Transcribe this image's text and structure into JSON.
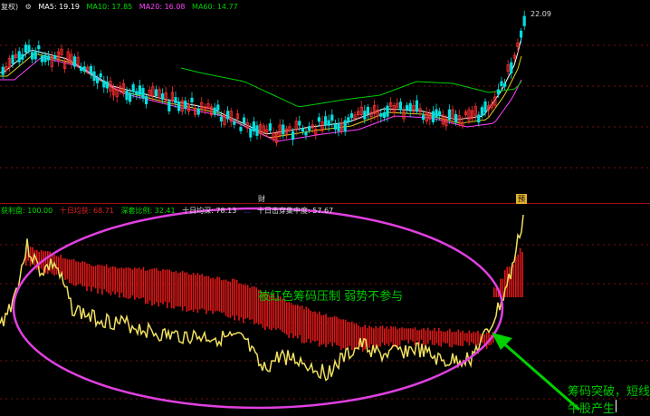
{
  "upper_legend": {
    "prefix": "复权)",
    "items": [
      {
        "label": "MA5: 19.19",
        "color": "#ffffff"
      },
      {
        "label": "MA10: 17.85",
        "color": "#00dd00"
      },
      {
        "label": "MA20: 16.08",
        "color": "#ff40ff"
      },
      {
        "label": "MA60: 14.77",
        "color": "#00cc00"
      }
    ]
  },
  "price_marker": "22.09",
  "lower_legend": {
    "items": [
      {
        "label": "获利盘: 100.00",
        "color": "#00dd00"
      },
      {
        "label": "十日均获: 68.71",
        "color": "#dd2222"
      },
      {
        "label": "深套比例: 32.41",
        "color": "#00dd00"
      },
      {
        "label": "十日均深: 78.13",
        "color": "#dddddd"
      },
      {
        "label": "...",
        "color": "#3355ff"
      },
      {
        "label": "十日击穿集中度: 57.67",
        "color": "#dddddd"
      }
    ]
  },
  "markers": {
    "left": "财",
    "right": "预"
  },
  "annotations": {
    "suppressed": "被红色筹码压制  弱势不参与",
    "breakout_line1": "筹码突破，短线",
    "breakout_line2": "牛股产生"
  },
  "colors": {
    "up": "#ff3030",
    "down": "#00e0e0",
    "chip": "#e01818",
    "line": "#f0e060",
    "ellipse": "#e040e0",
    "arrow": "#00d000"
  }
}
